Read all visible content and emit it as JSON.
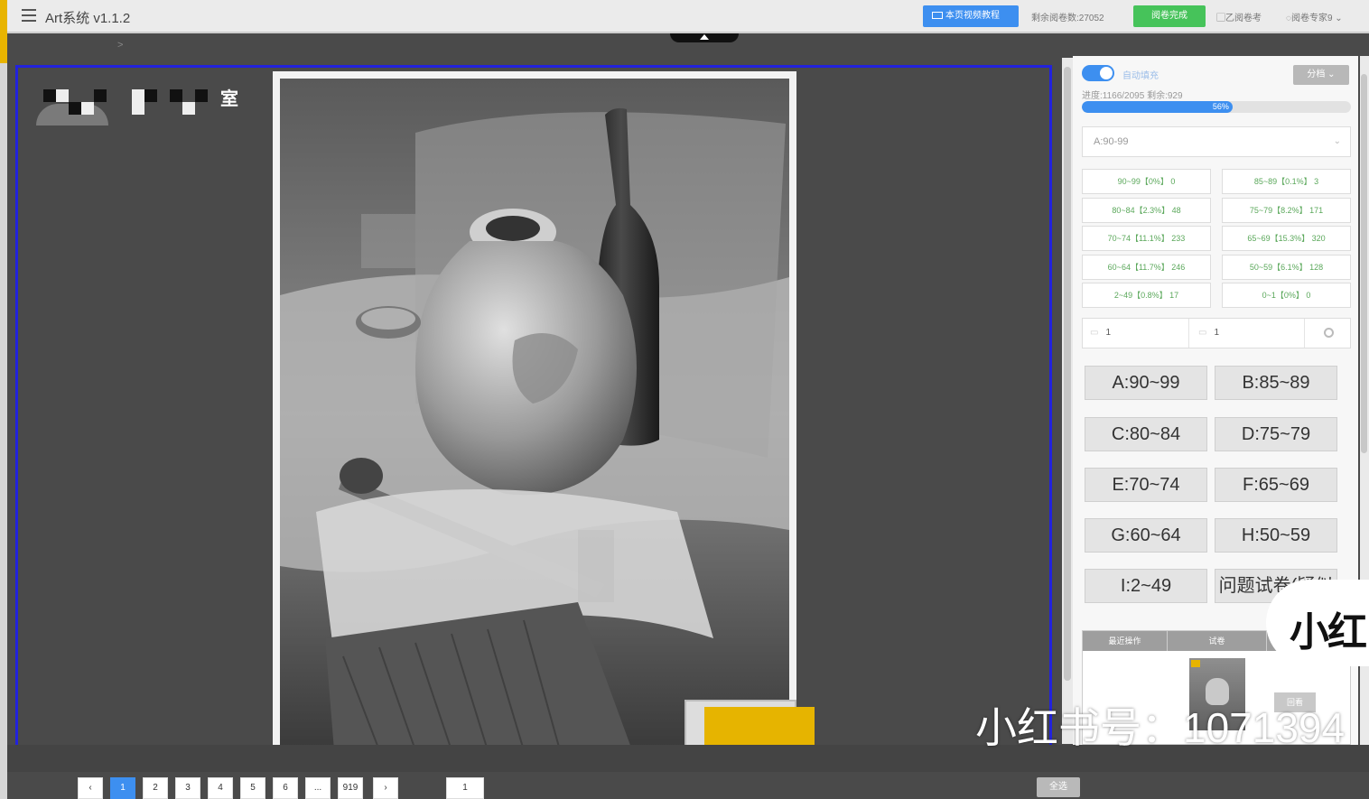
{
  "app": {
    "title": "Art系统 v1.1.2"
  },
  "topbar": {
    "video_label": "本页视频教程",
    "remaining_label": "剩余阅卷数:27052",
    "finish_label": "阅卷完成",
    "center_label": "乙阅卷考",
    "user_label": "阅卷专家9"
  },
  "viewer": {
    "school_suffix": "室"
  },
  "panel": {
    "auto_label": "自动填充",
    "sort_label": "分档",
    "progress_text": "进度:1166/2095   剩余:929",
    "progress_percent": 56,
    "progress_label": "56%",
    "grade_select_value": "A:90-99",
    "distribution": [
      {
        "label": "90~99【0%】 0"
      },
      {
        "label": "85~89【0.1%】 3"
      },
      {
        "label": "80~84【2.3%】 48"
      },
      {
        "label": "75~79【8.2%】 171"
      },
      {
        "label": "70~74【11.1%】 233"
      },
      {
        "label": "65~69【15.3%】 320"
      },
      {
        "label": "60~64【11.7%】 246"
      },
      {
        "label": "50~59【6.1%】 128"
      },
      {
        "label": "2~49【0.8%】 17"
      },
      {
        "label": "0~1【0%】 0"
      }
    ],
    "input_a_value": "1",
    "input_b_value": "1",
    "grade_buttons": [
      {
        "label": "A:90~99"
      },
      {
        "label": "B:85~89"
      },
      {
        "label": "C:80~84"
      },
      {
        "label": "D:75~79"
      },
      {
        "label": "E:70~74"
      },
      {
        "label": "F:65~69"
      },
      {
        "label": "G:60~64"
      },
      {
        "label": "H:50~59"
      },
      {
        "label": "I:2~49"
      },
      {
        "label": "问题试卷(疑似"
      }
    ],
    "recent_head": "最近操作",
    "paper_head": "试卷",
    "mini_btn": "回看"
  },
  "pager": {
    "pages": [
      "‹",
      "1",
      "2",
      "3",
      "4",
      "5",
      "6",
      "...",
      "919",
      "›"
    ],
    "goto_value": "1",
    "select_all_label": "全选"
  },
  "watermark": {
    "logo": "小红",
    "text": "小红书号：1071394"
  },
  "colors": {
    "accent": "#3d8ff0",
    "success": "#46c35a",
    "frame": "#2222dd",
    "stamp": "#e6b400"
  }
}
